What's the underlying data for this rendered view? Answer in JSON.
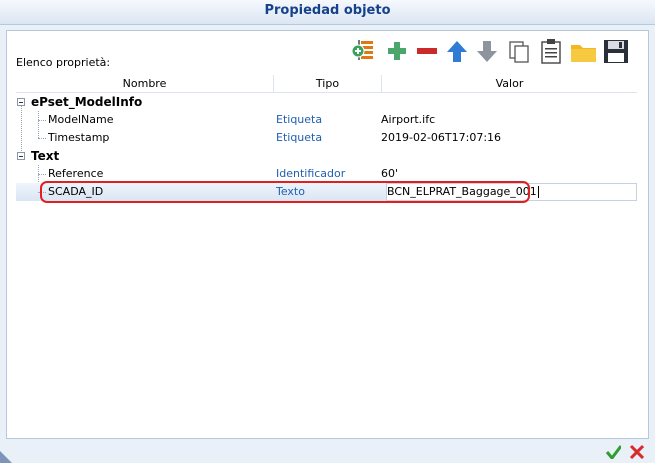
{
  "window": {
    "title": "Propiedad objeto"
  },
  "panel": {
    "label": "Elenco proprietà:"
  },
  "toolbar": {
    "buttons": [
      {
        "name": "add-pset-button",
        "icon": "add-pset-icon"
      },
      {
        "name": "add-property-button",
        "icon": "plus-icon"
      },
      {
        "name": "remove-property-button",
        "icon": "minus-icon"
      },
      {
        "name": "move-up-button",
        "icon": "arrow-up-icon"
      },
      {
        "name": "move-down-button",
        "icon": "arrow-down-icon"
      },
      {
        "name": "copy-button",
        "icon": "copy-icon"
      },
      {
        "name": "paste-button",
        "icon": "clipboard-icon"
      },
      {
        "name": "open-folder-button",
        "icon": "folder-icon"
      },
      {
        "name": "save-button",
        "icon": "floppy-disk-icon"
      }
    ]
  },
  "table": {
    "columns": [
      "Nombre",
      "Tipo",
      "Valor"
    ],
    "groups": [
      {
        "name": "ePset_ModelInfo",
        "rows": [
          {
            "name": "ModelName",
            "tipo": "Etiqueta",
            "valor": "Airport.ifc"
          },
          {
            "name": "Timestamp",
            "tipo": "Etiqueta",
            "valor": "2019-02-06T17:07:16"
          }
        ]
      },
      {
        "name": "Text",
        "rows": [
          {
            "name": "Reference",
            "tipo": "Identificador",
            "valor": "60'"
          },
          {
            "name": "SCADA_ID",
            "tipo": "Texto",
            "valor": "BCN_ELPRAT_Baggage_001"
          }
        ]
      }
    ]
  },
  "colors": {
    "title": "#15428b",
    "tipo_text": "#1f5fb0",
    "highlight": "#e02020",
    "ok": "#2e9e2e",
    "cancel": "#d92b2b"
  },
  "footer": {
    "ok_icon": "checkmark-icon",
    "cancel_icon": "x-icon"
  }
}
